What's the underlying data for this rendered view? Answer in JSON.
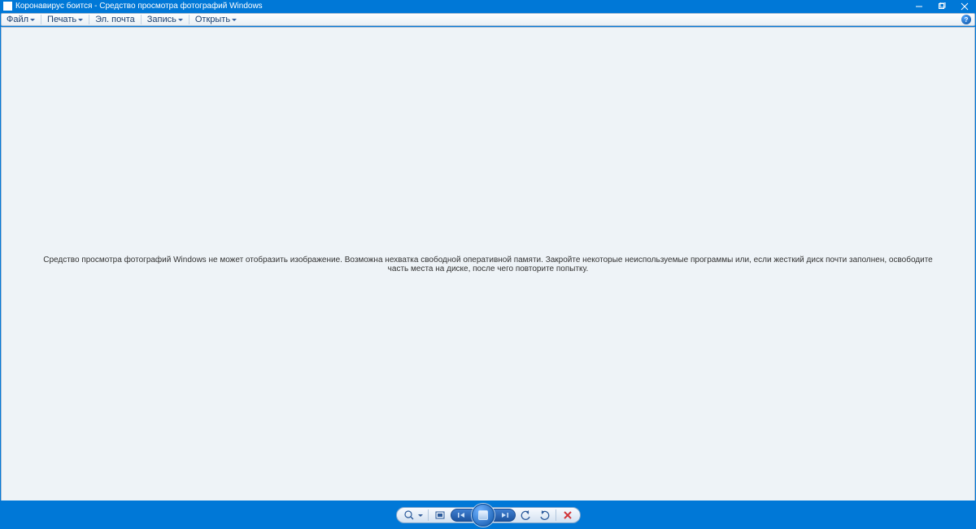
{
  "title": "Коронавирус боится - Средство просмотра фотографий Windows",
  "menu": {
    "file": "Файл",
    "print": "Печать",
    "email": "Эл. почта",
    "burn": "Запись",
    "open": "Открыть"
  },
  "help_tooltip": "?",
  "error_message": "Средство просмотра фотографий Windows не может отобразить изображение. Возможна нехватка свободной оперативной памяти. Закройте некоторые неиспользуемые программы или, если жесткий диск почти заполнен, освободите часть места на диске, после чего повторите попытку.",
  "controls": {
    "zoom": "zoom",
    "fit": "fit-to-window",
    "prev": "previous",
    "slideshow": "slideshow",
    "next": "next",
    "rotate_ccw": "rotate-counterclockwise",
    "rotate_cw": "rotate-clockwise",
    "delete": "delete"
  },
  "colors": {
    "accent": "#0078d7",
    "menu_text": "#1a3e6e",
    "panel_bg": "#eef3f7",
    "delete": "#d13438"
  }
}
